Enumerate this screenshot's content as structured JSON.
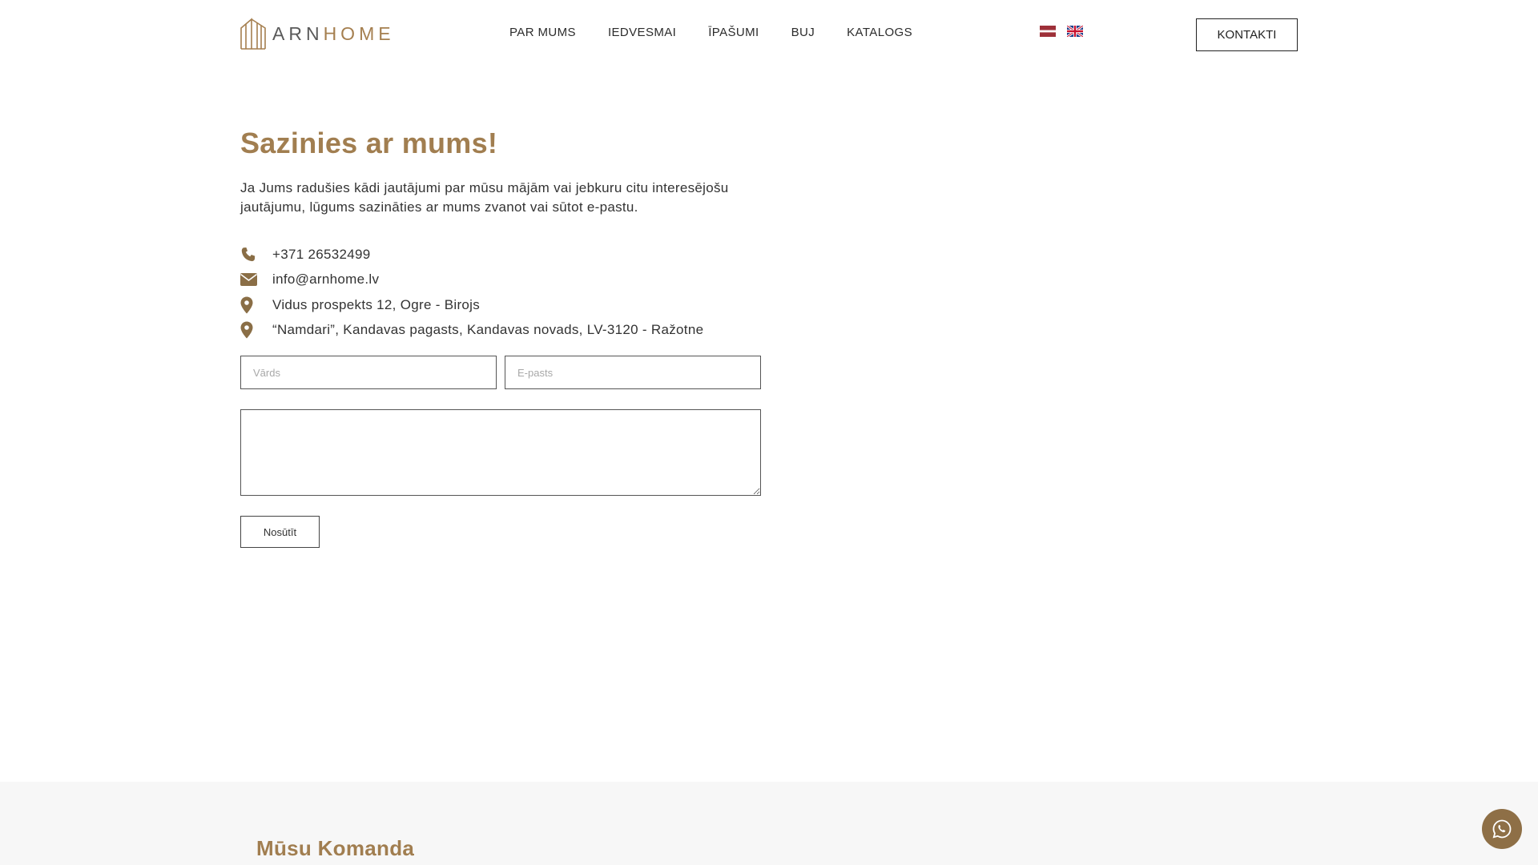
{
  "brand": {
    "name_part1": "ARN",
    "name_part2": "HOME"
  },
  "nav": {
    "items": [
      {
        "label": "PAR MUMS"
      },
      {
        "label": "IEDVESMAI"
      },
      {
        "label": "ĪPAŠUMI"
      },
      {
        "label": "BUJ"
      },
      {
        "label": "KATALOGS"
      }
    ],
    "contact_button": "KONTAKTI"
  },
  "languages": [
    {
      "code": "lv",
      "icon": "latvia-flag-icon"
    },
    {
      "code": "en",
      "icon": "uk-flag-icon"
    }
  ],
  "contact": {
    "title": "Sazinies ar mums!",
    "intro": "Ja Jums radušies kādi jautājumi par mūsu mājām vai jebkuru citu interesējošu jautājumu, lūgums sazināties ar mums zvanot vai sūtot e-pastu.",
    "phone": "+371 26532499",
    "email": "info@arnhome.lv",
    "address_office": "Vidus prospekts 12, Ogre - Birojs",
    "address_factory": "“Namdari”, Kandavas pagasts, Kandavas novads, LV-3120 - Ražotne"
  },
  "form": {
    "name_placeholder": "Vārds",
    "email_placeholder": "E-pasts",
    "message_placeholder": "",
    "submit_label": "Nosūtīt"
  },
  "team": {
    "title": "Mūsu Komanda"
  },
  "colors": {
    "accent": "#a17e50",
    "whatsapp_bg": "#8e6f46",
    "section_bg": "#f7f7f7"
  }
}
